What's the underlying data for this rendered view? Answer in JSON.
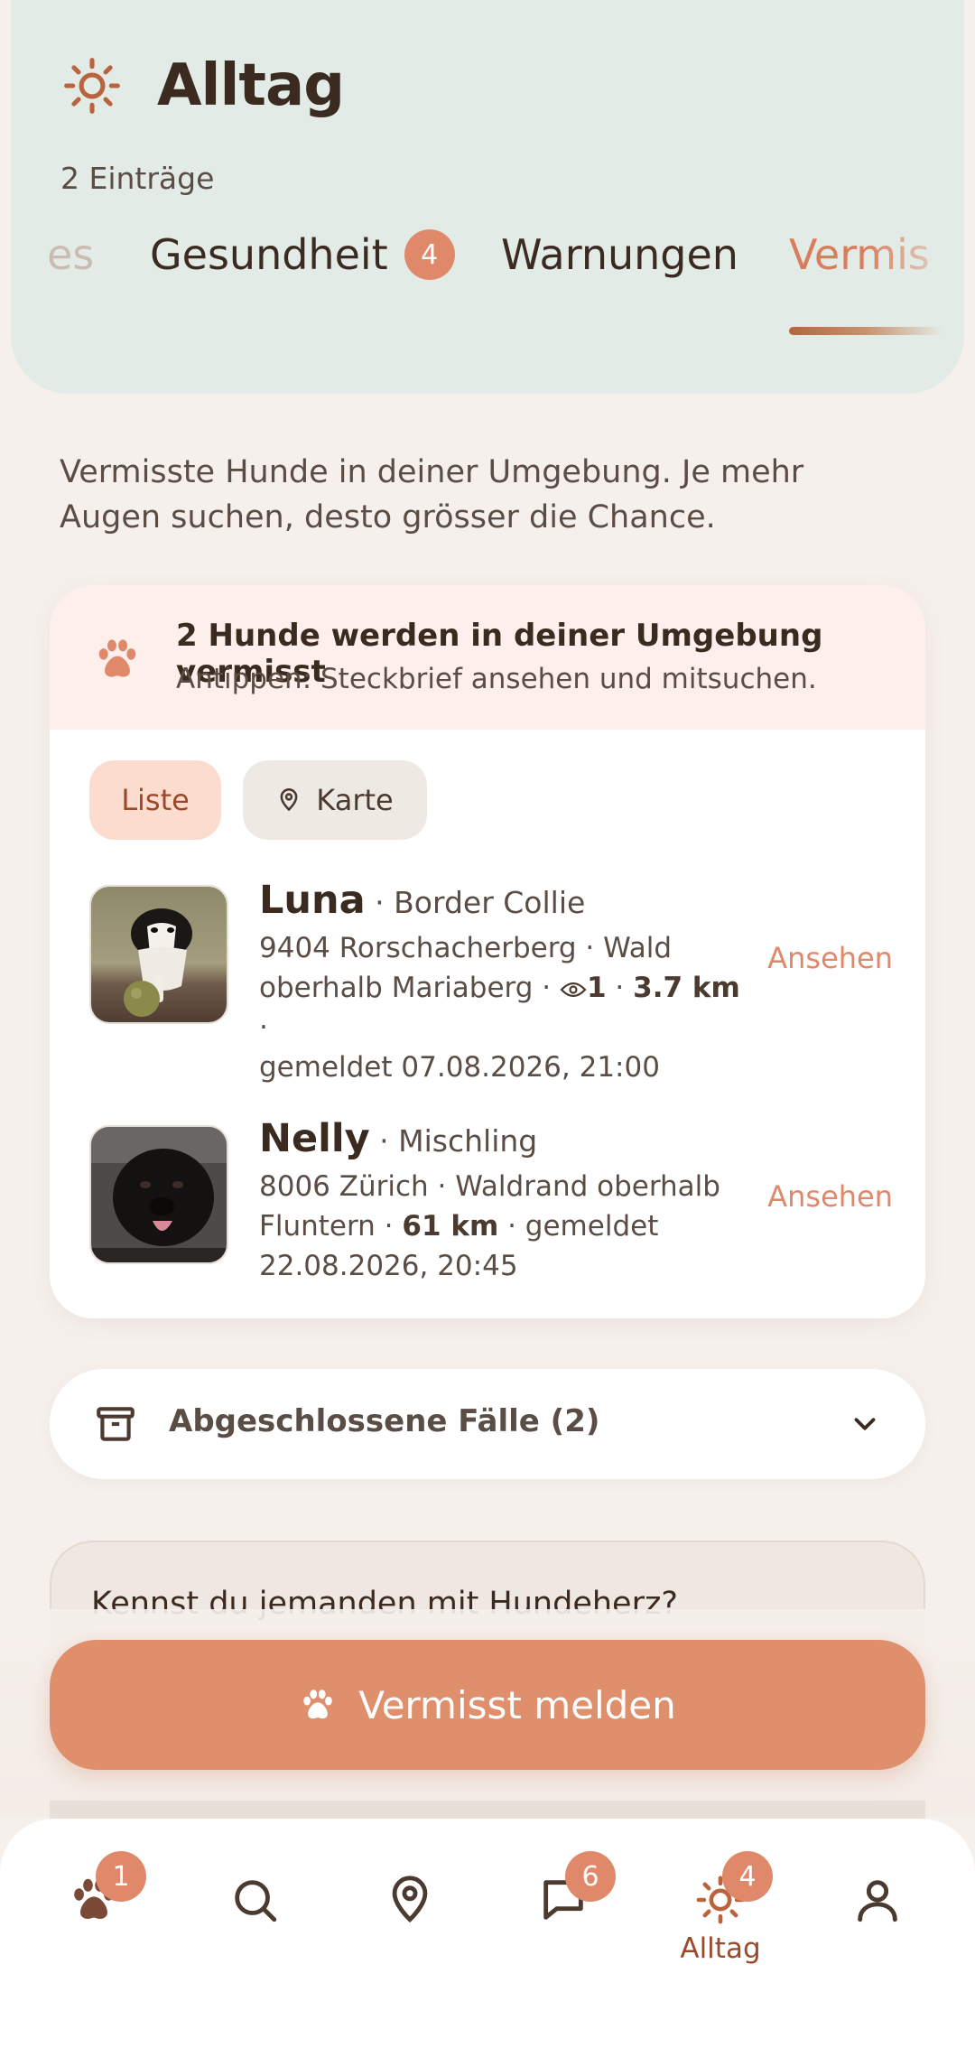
{
  "header": {
    "title": "Alltag",
    "title_icon": "sun-icon",
    "subtitle": "2 Einträge"
  },
  "tabs": [
    {
      "label": "es",
      "state": "faded"
    },
    {
      "label": "Gesundheit",
      "badge": "4"
    },
    {
      "label": "Warnungen"
    },
    {
      "label": "Vermis",
      "state": "active"
    }
  ],
  "intro_text": "Vermisste Hunde in deiner Umgebung. Je mehr Augen suchen, desto grösser die Chance.",
  "alert": {
    "icon": "paw-icon",
    "title": "2 Hunde werden in deiner Umgebung vermisst",
    "subtitle": "Antippen: Steckbrief ansehen und mitsuchen."
  },
  "view_toggle": {
    "list_label": "Liste",
    "map_label": "Karte",
    "selected": "Liste"
  },
  "dogs": [
    {
      "name": "Luna",
      "breed": " · Border Collie",
      "line1": "9404 Rorschacherberg · Wald",
      "line2_prefix": "oberhalb Mariaberg · ",
      "views": "1",
      "distance": "3.7 km",
      "line3": "gemeldet 07.08.2026, 21:00",
      "action": "Ansehen"
    },
    {
      "name": "Nelly",
      "breed": " · Mischling",
      "line1": "8006 Zürich · Waldrand oberhalb",
      "line2_prefix": "Fluntern · ",
      "distance": "61 km",
      "line2_suffix": " · gemeldet",
      "line3": "22.08.2026, 20:45",
      "action": "Ansehen"
    }
  ],
  "closed_cases": {
    "label": "Abgeschlossene Fälle (2)",
    "icon": "archive-icon"
  },
  "promo": {
    "text": "Kennst du jemanden mit Hundeherz?"
  },
  "fab": {
    "label": "Vermisst melden",
    "icon": "paw-icon"
  },
  "bottom_nav": {
    "items": [
      {
        "icon": "paw-icon",
        "badge": "1"
      },
      {
        "icon": "search-icon"
      },
      {
        "icon": "map-pin-icon"
      },
      {
        "icon": "chat-icon",
        "badge": "6"
      },
      {
        "icon": "sun-icon",
        "badge": "4",
        "label": "Alltag",
        "active": true
      },
      {
        "icon": "profile-icon"
      }
    ]
  },
  "colors": {
    "accent": "#e0896a",
    "header_bg": "#e3ebe6",
    "page_bg": "#f6f0ec",
    "alert_bg": "#fcefec"
  }
}
